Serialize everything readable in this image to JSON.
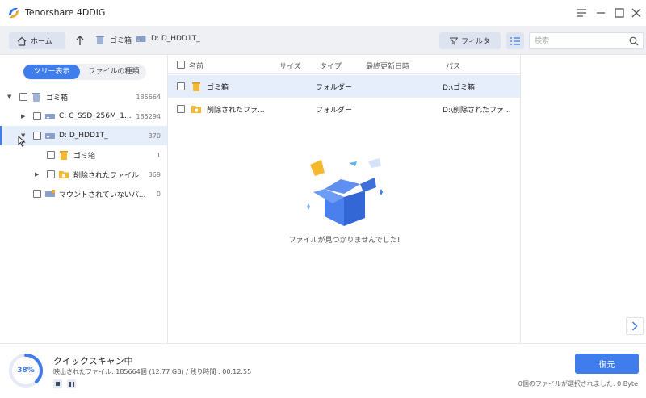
{
  "app": {
    "title": "Tenorshare 4DDiG",
    "accent": "#3f7cec"
  },
  "toolbar": {
    "home_label": "ホーム",
    "breadcrumb": [
      "ゴミ箱",
      "D: D_HDD1T_"
    ],
    "filter_label": "フィルタ",
    "search_placeholder": "検索"
  },
  "view_tabs": {
    "tree": "ツリー表示",
    "type": "ファイルの種類"
  },
  "tree": [
    {
      "label": "ゴミ箱",
      "count": "185664",
      "icon": "trash-icon"
    },
    {
      "label": "C: C_SSD_256M_1...",
      "count": "185294",
      "icon": "drive-icon"
    },
    {
      "label": "D: D_HDD1T_",
      "count": "370",
      "icon": "drive-icon"
    },
    {
      "label": "ゴミ箱",
      "count": "1",
      "icon": "trash-icon"
    },
    {
      "label": "削除されたファイル",
      "count": "369",
      "icon": "folder-icon"
    },
    {
      "label": "マウントされていないパ...",
      "count": "0",
      "icon": "drive-icon"
    }
  ],
  "file_list": {
    "columns": [
      "名前",
      "サイズ",
      "タイプ",
      "最終更新日時",
      "パス"
    ],
    "rows": [
      {
        "name": "ゴミ箱",
        "size": "",
        "type": "フォルダー",
        "modified": "",
        "path": "D:\\ゴミ箱"
      },
      {
        "name": "削除されたファ...",
        "size": "",
        "type": "フォルダー",
        "modified": "",
        "path": "D:\\削除されたファ..."
      }
    ],
    "empty_message": "ファイルが見つかりませんでした!"
  },
  "status": {
    "progress_label": "38%",
    "progress_value": 0.38,
    "title": "クイックスキャン中",
    "detail": "映出されたファイル: 185664個 (12.77 GB) / 残り時間 : 00:12:55",
    "selected_info": "0個のファイルが選択されました: 0 Byte",
    "recover_label": "復元"
  }
}
